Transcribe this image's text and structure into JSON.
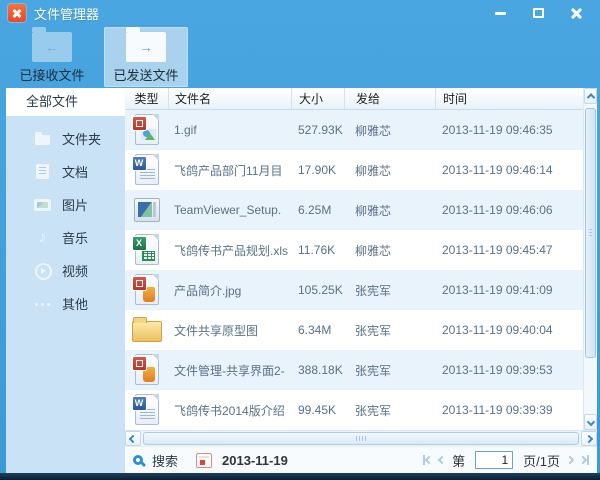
{
  "window": {
    "title": "文件管理器",
    "app_icon": "cross-logo-icon",
    "controls": {
      "minimize": "minimize",
      "maximize": "maximize",
      "close": "close"
    }
  },
  "colors": {
    "frame_blue": "#3f9fdc",
    "toolbar_active_bg": "#a9d2ee",
    "sidebar_bg": "#c9e2f5",
    "row_alt_bg": "#e9f3fb",
    "app_icon_orange": "#ef5c33",
    "cell_text": "#597188"
  },
  "toolbar": {
    "buttons": [
      {
        "label": "已接收文件",
        "icon": "folder-receive-icon",
        "arrow": "←",
        "active": false
      },
      {
        "label": "已发送文件",
        "icon": "folder-send-icon",
        "arrow": "→",
        "active": true
      }
    ]
  },
  "sidebar": {
    "all_files_label": "全部文件",
    "items": [
      {
        "label": "文件夹",
        "icon": "folder-icon"
      },
      {
        "label": "文档",
        "icon": "document-icon"
      },
      {
        "label": "图片",
        "icon": "picture-icon"
      },
      {
        "label": "音乐",
        "icon": "music-icon"
      },
      {
        "label": "视频",
        "icon": "video-icon"
      },
      {
        "label": "其他",
        "icon": "more-icon"
      }
    ]
  },
  "table": {
    "columns": [
      "类型",
      "文件名",
      "大小",
      "发给",
      "时间"
    ],
    "rows": [
      {
        "icon": "image",
        "name": "1.gif",
        "size": "527.93K",
        "to": "柳雅芯",
        "time": "2013-11-19 09:46:35"
      },
      {
        "icon": "word",
        "name": "飞鸽产品部门11月目",
        "size": "17.90K",
        "to": "柳雅芯",
        "time": "2013-11-19 09:46:14"
      },
      {
        "icon": "app",
        "name": "TeamViewer_Setup.",
        "size": "6.25M",
        "to": "柳雅芯",
        "time": "2013-11-19 09:46:06"
      },
      {
        "icon": "excel",
        "name": "飞鸽传书产品规划.xls",
        "size": "11.76K",
        "to": "柳雅芯",
        "time": "2013-11-19 09:45:47"
      },
      {
        "icon": "jpg",
        "name": "产品简介.jpg",
        "size": "105.25K",
        "to": "张宪军",
        "time": "2013-11-19 09:41:09"
      },
      {
        "icon": "folder",
        "name": "文件共享原型图",
        "size": "6.34M",
        "to": "张宪军",
        "time": "2013-11-19 09:40:04"
      },
      {
        "icon": "jpg",
        "name": "文件管理-共享界面2-",
        "size": "388.18K",
        "to": "张宪军",
        "time": "2013-11-19 09:39:53"
      },
      {
        "icon": "word",
        "name": "飞鸽传书2014版介绍",
        "size": "99.45K",
        "to": "张宪军",
        "time": "2013-11-19 09:39:39"
      }
    ]
  },
  "statusbar": {
    "search_label": "搜索",
    "search_icon": "magnifier-icon",
    "date_icon": "calendar-icon",
    "date_value": "2013-11-19",
    "pagination": {
      "prefix": "第",
      "page_value": "1",
      "suffix": "页/1页"
    }
  }
}
